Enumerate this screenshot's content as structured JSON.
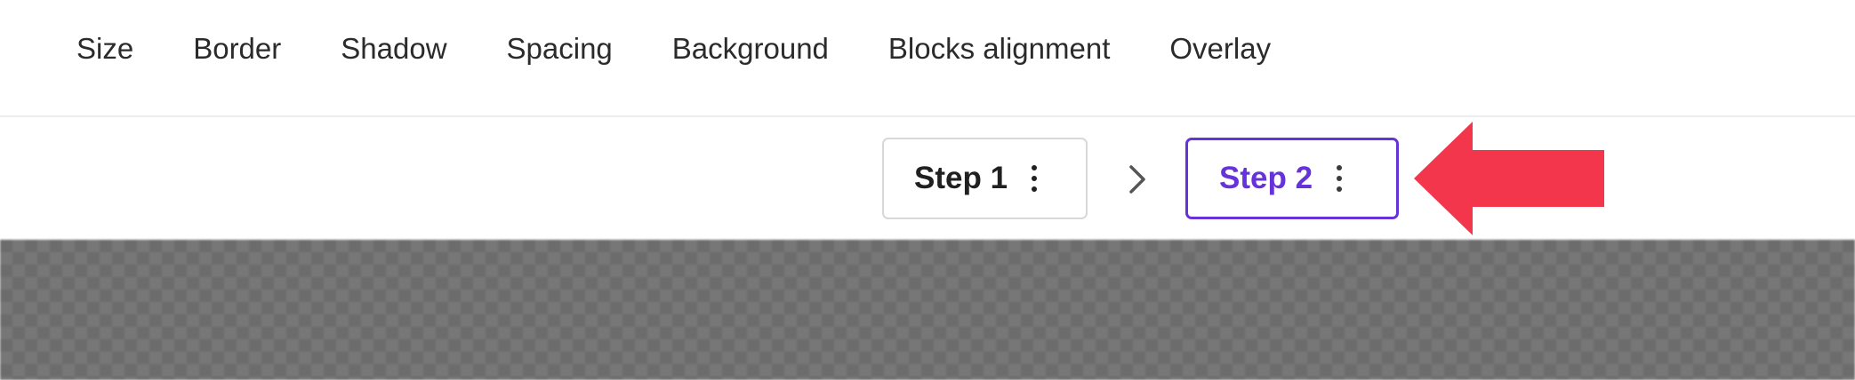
{
  "menu": {
    "items": [
      {
        "label": "Size"
      },
      {
        "label": "Border"
      },
      {
        "label": "Shadow"
      },
      {
        "label": "Spacing"
      },
      {
        "label": "Background"
      },
      {
        "label": "Blocks alignment"
      },
      {
        "label": "Overlay"
      }
    ]
  },
  "steps": {
    "step1": {
      "label": "Step 1",
      "options_icon": "kebab-menu-icon"
    },
    "separator_icon": "chevron-right-icon",
    "step2": {
      "label": "Step 2",
      "options_icon": "kebab-menu-icon",
      "state": "selected"
    }
  },
  "annotation": {
    "icon": "red-arrow-left-icon"
  },
  "colors": {
    "accent": "#6533d9",
    "annotation": "#f4364c",
    "canvas": "#6c6c6c",
    "text": "#2b2b2b"
  }
}
